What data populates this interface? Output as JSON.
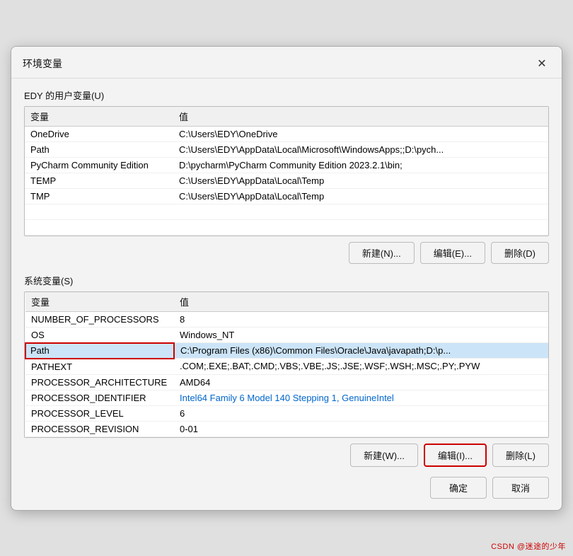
{
  "dialog": {
    "title": "环境变量",
    "close_label": "✕"
  },
  "user_section": {
    "title": "EDY 的用户变量(U)",
    "columns": [
      "变量",
      "值"
    ],
    "rows": [
      {
        "var": "OneDrive",
        "val": "C:\\Users\\EDY\\OneDrive"
      },
      {
        "var": "Path",
        "val": "C:\\Users\\EDY\\AppData\\Local\\Microsoft\\WindowsApps;;D:\\pych..."
      },
      {
        "var": "PyCharm Community Edition",
        "val": "D:\\pycharm\\PyCharm Community Edition 2023.2.1\\bin;"
      },
      {
        "var": "TEMP",
        "val": "C:\\Users\\EDY\\AppData\\Local\\Temp"
      },
      {
        "var": "TMP",
        "val": "C:\\Users\\EDY\\AppData\\Local\\Temp"
      }
    ],
    "buttons": [
      {
        "id": "user-new",
        "label": "新建(N)..."
      },
      {
        "id": "user-edit",
        "label": "编辑(E)..."
      },
      {
        "id": "user-delete",
        "label": "删除(D)"
      }
    ]
  },
  "system_section": {
    "title": "系统变量(S)",
    "columns": [
      "变量",
      "值"
    ],
    "rows": [
      {
        "var": "NUMBER_OF_PROCESSORS",
        "val": "8"
      },
      {
        "var": "OS",
        "val": "Windows_NT"
      },
      {
        "var": "Path",
        "val": "C:\\Program Files (x86)\\Common Files\\Oracle\\Java\\javapath;D:\\p...",
        "selected": true
      },
      {
        "var": "PATHEXT",
        "val": ".COM;.EXE;.BAT;.CMD;.VBS;.VBE;.JS;.JSE;.WSF;.WSH;.MSC;.PY;.PYW"
      },
      {
        "var": "PROCESSOR_ARCHITECTURE",
        "val": "AMD64"
      },
      {
        "var": "PROCESSOR_IDENTIFIER",
        "val": "Intel64 Family 6 Model 140 Stepping 1, GenuineIntel",
        "link": true
      },
      {
        "var": "PROCESSOR_LEVEL",
        "val": "6"
      },
      {
        "var": "PROCESSOR_REVISION",
        "val": "0-01"
      }
    ],
    "buttons": [
      {
        "id": "sys-new",
        "label": "新建(W)..."
      },
      {
        "id": "sys-edit",
        "label": "编辑(I)...",
        "highlighted": true
      },
      {
        "id": "sys-delete",
        "label": "删除(L)"
      }
    ]
  },
  "footer": {
    "confirm_label": "确定",
    "cancel_label": "取消"
  },
  "watermark": "CSDN @迷途的少年"
}
